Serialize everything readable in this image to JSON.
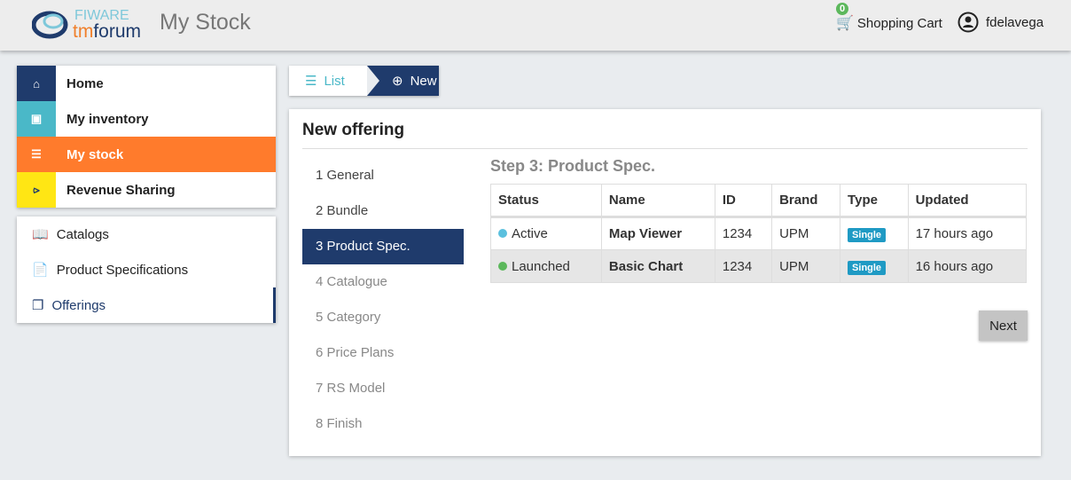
{
  "header": {
    "logo_text": "FIWARE tmforum",
    "title": "My Stock",
    "cart_label": "Shopping Cart",
    "cart_count": "0",
    "username": "fdelavega"
  },
  "main_nav": [
    {
      "label": "Home",
      "icon": "home-icon",
      "color": "#1f3b6c"
    },
    {
      "label": "My inventory",
      "icon": "archive-icon",
      "color": "#4ab8c8"
    },
    {
      "label": "My stock",
      "icon": "database-icon",
      "color": "#ff7b2c",
      "active": true
    },
    {
      "label": "Revenue Sharing",
      "icon": "share-icon",
      "color": "#ffe614"
    }
  ],
  "sub_nav": [
    {
      "label": "Catalogs",
      "icon": "book-icon"
    },
    {
      "label": "Product Specifications",
      "icon": "file-icon"
    },
    {
      "label": "Offerings",
      "icon": "cube-icon",
      "active": true
    }
  ],
  "breadcrumb": {
    "list": "List",
    "new": "New"
  },
  "form": {
    "title": "New offering",
    "step_title": "Step 3: Product Spec.",
    "next": "Next",
    "steps": [
      "1 General",
      "2 Bundle",
      "3 Product Spec.",
      "4 Catalogue",
      "5 Category",
      "6 Price Plans",
      "7 RS Model",
      "8 Finish"
    ],
    "active_step": 3
  },
  "table": {
    "headers": [
      "Status",
      "Name",
      "ID",
      "Brand",
      "Type",
      "Updated"
    ],
    "rows": [
      {
        "status": "Active",
        "status_color": "#5bc0de",
        "name": "Map Viewer",
        "id": "1234",
        "brand": "UPM",
        "type": "Single",
        "updated": "17 hours ago"
      },
      {
        "status": "Launched",
        "status_color": "#5cb85c",
        "name": "Basic Chart",
        "id": "1234",
        "brand": "UPM",
        "type": "Single",
        "updated": "16 hours ago"
      }
    ]
  }
}
